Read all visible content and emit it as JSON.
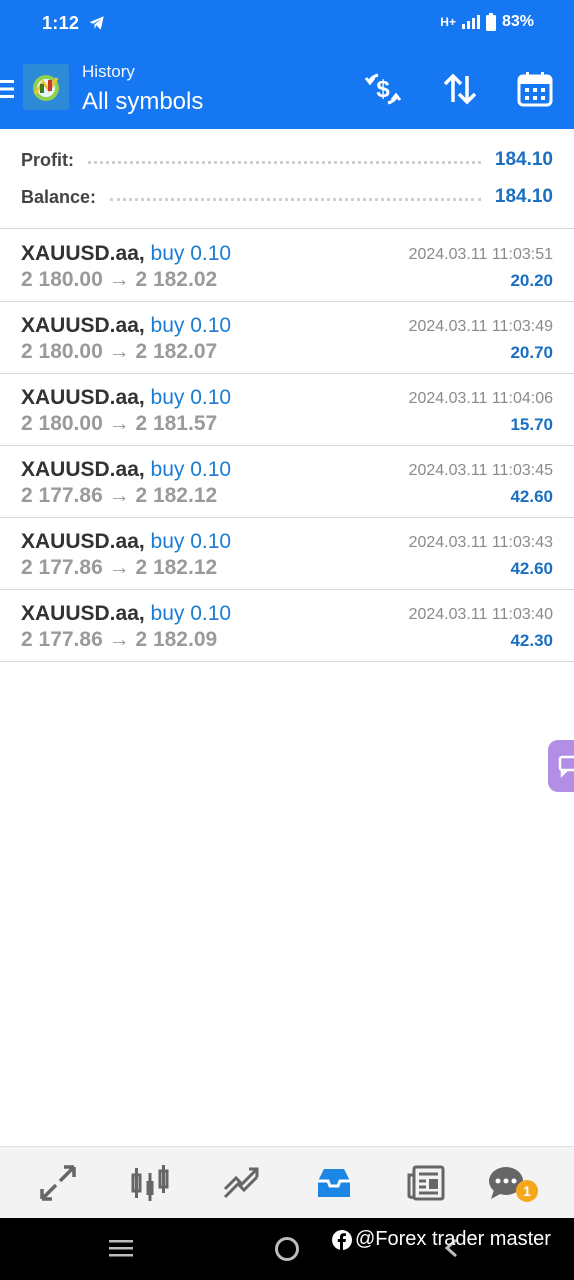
{
  "status_bar": {
    "time": "1:12",
    "network": "H+",
    "battery": "83%",
    "icons": [
      "telegram-icon",
      "signal-icon",
      "battery-icon"
    ]
  },
  "header": {
    "subtitle": "History",
    "title": "All symbols",
    "actions": [
      "currency-exchange-icon",
      "sort-icon",
      "calendar-icon"
    ],
    "color": "#1677f2"
  },
  "summary": {
    "profit_label": "Profit:",
    "profit_value": "184.10",
    "balance_label": "Balance:",
    "balance_value": "184.10"
  },
  "trades": [
    {
      "symbol": "XAUUSD.aa,",
      "side": "buy 0.10",
      "open": "2 180.00",
      "close": "2 182.02",
      "time": "2024.03.11 11:03:51",
      "profit": "20.20"
    },
    {
      "symbol": "XAUUSD.aa,",
      "side": "buy 0.10",
      "open": "2 180.00",
      "close": "2 182.07",
      "time": "2024.03.11 11:03:49",
      "profit": "20.70"
    },
    {
      "symbol": "XAUUSD.aa,",
      "side": "buy 0.10",
      "open": "2 180.00",
      "close": "2 181.57",
      "time": "2024.03.11 11:04:06",
      "profit": "15.70"
    },
    {
      "symbol": "XAUUSD.aa,",
      "side": "buy 0.10",
      "open": "2 177.86",
      "close": "2 182.12",
      "time": "2024.03.11 11:03:45",
      "profit": "42.60"
    },
    {
      "symbol": "XAUUSD.aa,",
      "side": "buy 0.10",
      "open": "2 177.86",
      "close": "2 182.12",
      "time": "2024.03.11 11:03:43",
      "profit": "42.60"
    },
    {
      "symbol": "XAUUSD.aa,",
      "side": "buy 0.10",
      "open": "2 177.86",
      "close": "2 182.09",
      "time": "2024.03.11 11:03:40",
      "profit": "42.30"
    }
  ],
  "arrow": "→",
  "tabbar": {
    "tabs": [
      "quotes-icon",
      "chart-icon",
      "trade-icon",
      "history-icon",
      "news-icon",
      "chat-icon"
    ],
    "active": "history-icon",
    "chat_badge": "1"
  },
  "watermark": "@Forex trader master"
}
